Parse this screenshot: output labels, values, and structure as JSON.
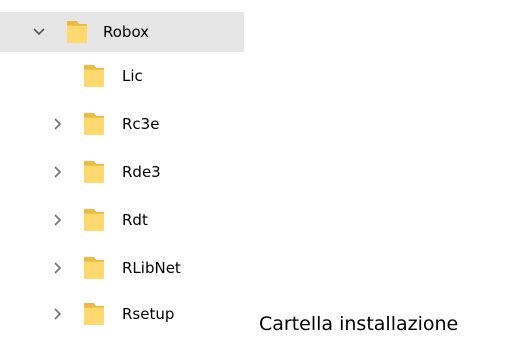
{
  "tree": {
    "root": {
      "label": "Robox",
      "expanded": true,
      "selected": true,
      "icon": "folder-icon"
    },
    "children": [
      {
        "label": "Lic",
        "has_children": false,
        "icon": "folder-icon"
      },
      {
        "label": "Rc3e",
        "has_children": true,
        "icon": "folder-icon"
      },
      {
        "label": "Rde3",
        "has_children": true,
        "icon": "folder-icon"
      },
      {
        "label": "Rdt",
        "has_children": true,
        "icon": "folder-icon"
      },
      {
        "label": "RLibNet",
        "has_children": true,
        "icon": "folder-icon"
      },
      {
        "label": "Rsetup",
        "has_children": true,
        "icon": "folder-icon"
      }
    ]
  },
  "caption": "Cartella installazione",
  "colors": {
    "selection": "#e5e5e5",
    "folder_fill": "#ffd970",
    "folder_back": "#e9b94a",
    "chevron": "#707070"
  }
}
